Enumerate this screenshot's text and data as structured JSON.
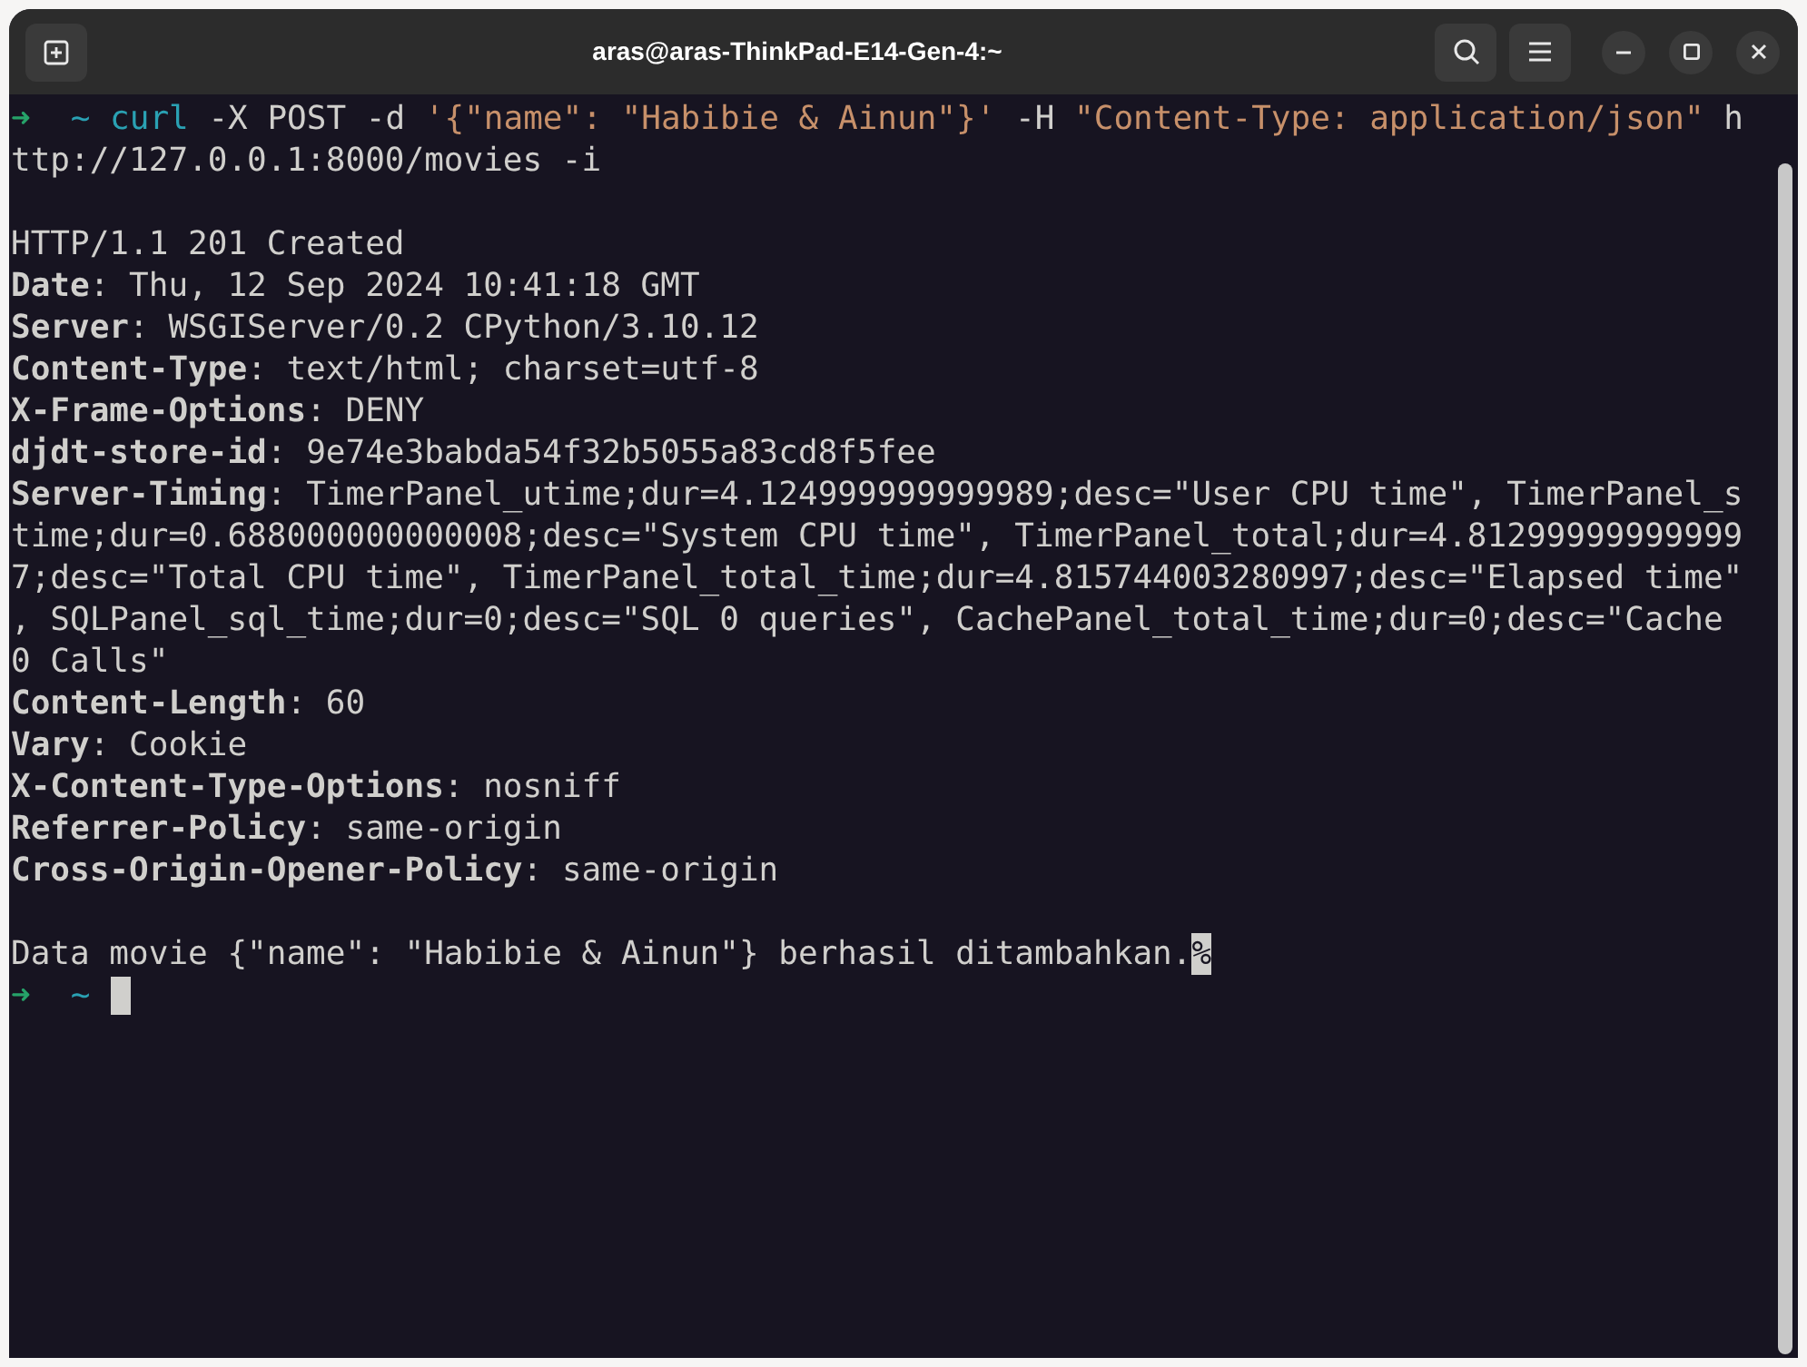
{
  "window": {
    "title": "aras@aras-ThinkPad-E14-Gen-4:~"
  },
  "terminal": {
    "lines": [
      {
        "kind": "command",
        "prompt_arrow": "➜",
        "prompt_dir": "~",
        "tokens": [
          {
            "kind": "program",
            "text": "curl"
          },
          {
            "kind": "plain",
            "text": "-X POST -d"
          },
          {
            "kind": "string",
            "text": "'{\"name\": \"Habibie & Ainun\"}'"
          },
          {
            "kind": "plain",
            "text": "-H"
          },
          {
            "kind": "string",
            "text": "\"Content-Type: application/json\""
          },
          {
            "kind": "plain",
            "text": "h"
          }
        ]
      },
      {
        "kind": "text",
        "text": "ttp://127.0.0.1:8000/movies -i"
      },
      {
        "kind": "blank"
      },
      {
        "kind": "text",
        "text": "HTTP/1.1 201 Created"
      },
      {
        "kind": "header",
        "name": "Date",
        "separator": ":",
        "value": "Thu, 12 Sep 2024 10:41:18 GMT"
      },
      {
        "kind": "header",
        "name": "Server",
        "separator": ":",
        "value": "WSGIServer/0.2 CPython/3.10.12"
      },
      {
        "kind": "header",
        "name": "Content-Type",
        "separator": ":",
        "value": "text/html; charset=utf-8"
      },
      {
        "kind": "header",
        "name": "X-Frame-Options",
        "separator": ":",
        "value": "DENY"
      },
      {
        "kind": "header",
        "name": "djdt-store-id",
        "separator": ":",
        "value": "9e74e3babda54f32b5055a83cd8f5fee"
      },
      {
        "kind": "header",
        "name": "Server-Timing",
        "separator": ":",
        "value": "TimerPanel_utime;dur=4.124999999999989;desc=\"User CPU time\", TimerPanel_s"
      },
      {
        "kind": "text",
        "text": "time;dur=0.688000000000008;desc=\"System CPU time\", TimerPanel_total;dur=4.81299999999999"
      },
      {
        "kind": "text",
        "text": "7;desc=\"Total CPU time\", TimerPanel_total_time;dur=4.815744003280997;desc=\"Elapsed time\""
      },
      {
        "kind": "text",
        "text": ", SQLPanel_sql_time;dur=0;desc=\"SQL 0 queries\", CachePanel_total_time;dur=0;desc=\"Cache"
      },
      {
        "kind": "text",
        "text": "0 Calls\""
      },
      {
        "kind": "header",
        "name": "Content-Length",
        "separator": ":",
        "value": "60"
      },
      {
        "kind": "header",
        "name": "Vary",
        "separator": ":",
        "value": "Cookie"
      },
      {
        "kind": "header",
        "name": "X-Content-Type-Options",
        "separator": ":",
        "value": "nosniff"
      },
      {
        "kind": "header",
        "name": "Referrer-Policy",
        "separator": ":",
        "value": "same-origin"
      },
      {
        "kind": "header",
        "name": "Cross-Origin-Opener-Policy",
        "separator": ":",
        "value": "same-origin"
      },
      {
        "kind": "blank"
      },
      {
        "kind": "text",
        "text": "Data movie {\"name\": \"Habibie & Ainun\"} berhasil ditambahkan.",
        "end_mark": "%"
      },
      {
        "kind": "prompt",
        "prompt_arrow": "➜",
        "prompt_dir": "~"
      }
    ]
  }
}
